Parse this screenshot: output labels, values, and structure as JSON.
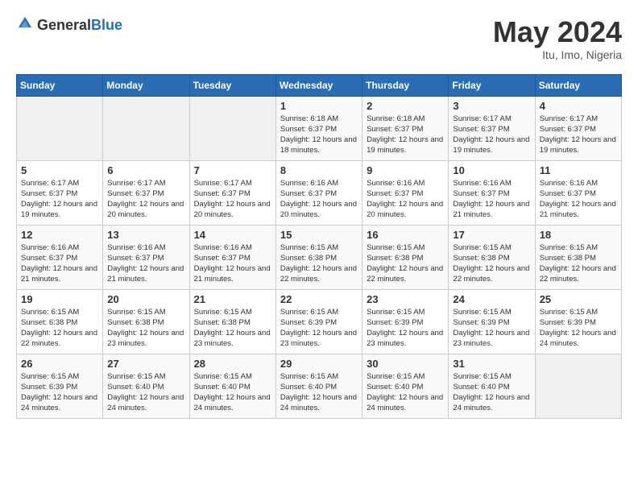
{
  "header": {
    "logo_general": "General",
    "logo_blue": "Blue",
    "month": "May 2024",
    "location": "Itu, Imo, Nigeria"
  },
  "weekdays": [
    "Sunday",
    "Monday",
    "Tuesday",
    "Wednesday",
    "Thursday",
    "Friday",
    "Saturday"
  ],
  "weeks": [
    [
      {
        "day": "",
        "sunrise": "",
        "sunset": "",
        "daylight": ""
      },
      {
        "day": "",
        "sunrise": "",
        "sunset": "",
        "daylight": ""
      },
      {
        "day": "",
        "sunrise": "",
        "sunset": "",
        "daylight": ""
      },
      {
        "day": "1",
        "sunrise": "6:18 AM",
        "sunset": "6:37 PM",
        "daylight": "12 hours and 18 minutes."
      },
      {
        "day": "2",
        "sunrise": "6:18 AM",
        "sunset": "6:37 PM",
        "daylight": "12 hours and 19 minutes."
      },
      {
        "day": "3",
        "sunrise": "6:17 AM",
        "sunset": "6:37 PM",
        "daylight": "12 hours and 19 minutes."
      },
      {
        "day": "4",
        "sunrise": "6:17 AM",
        "sunset": "6:37 PM",
        "daylight": "12 hours and 19 minutes."
      }
    ],
    [
      {
        "day": "5",
        "sunrise": "6:17 AM",
        "sunset": "6:37 PM",
        "daylight": "12 hours and 19 minutes."
      },
      {
        "day": "6",
        "sunrise": "6:17 AM",
        "sunset": "6:37 PM",
        "daylight": "12 hours and 20 minutes."
      },
      {
        "day": "7",
        "sunrise": "6:17 AM",
        "sunset": "6:37 PM",
        "daylight": "12 hours and 20 minutes."
      },
      {
        "day": "8",
        "sunrise": "6:16 AM",
        "sunset": "6:37 PM",
        "daylight": "12 hours and 20 minutes."
      },
      {
        "day": "9",
        "sunrise": "6:16 AM",
        "sunset": "6:37 PM",
        "daylight": "12 hours and 20 minutes."
      },
      {
        "day": "10",
        "sunrise": "6:16 AM",
        "sunset": "6:37 PM",
        "daylight": "12 hours and 21 minutes."
      },
      {
        "day": "11",
        "sunrise": "6:16 AM",
        "sunset": "6:37 PM",
        "daylight": "12 hours and 21 minutes."
      }
    ],
    [
      {
        "day": "12",
        "sunrise": "6:16 AM",
        "sunset": "6:37 PM",
        "daylight": "12 hours and 21 minutes."
      },
      {
        "day": "13",
        "sunrise": "6:16 AM",
        "sunset": "6:37 PM",
        "daylight": "12 hours and 21 minutes."
      },
      {
        "day": "14",
        "sunrise": "6:16 AM",
        "sunset": "6:37 PM",
        "daylight": "12 hours and 21 minutes."
      },
      {
        "day": "15",
        "sunrise": "6:15 AM",
        "sunset": "6:38 PM",
        "daylight": "12 hours and 22 minutes."
      },
      {
        "day": "16",
        "sunrise": "6:15 AM",
        "sunset": "6:38 PM",
        "daylight": "12 hours and 22 minutes."
      },
      {
        "day": "17",
        "sunrise": "6:15 AM",
        "sunset": "6:38 PM",
        "daylight": "12 hours and 22 minutes."
      },
      {
        "day": "18",
        "sunrise": "6:15 AM",
        "sunset": "6:38 PM",
        "daylight": "12 hours and 22 minutes."
      }
    ],
    [
      {
        "day": "19",
        "sunrise": "6:15 AM",
        "sunset": "6:38 PM",
        "daylight": "12 hours and 22 minutes."
      },
      {
        "day": "20",
        "sunrise": "6:15 AM",
        "sunset": "6:38 PM",
        "daylight": "12 hours and 23 minutes."
      },
      {
        "day": "21",
        "sunrise": "6:15 AM",
        "sunset": "6:38 PM",
        "daylight": "12 hours and 23 minutes."
      },
      {
        "day": "22",
        "sunrise": "6:15 AM",
        "sunset": "6:39 PM",
        "daylight": "12 hours and 23 minutes."
      },
      {
        "day": "23",
        "sunrise": "6:15 AM",
        "sunset": "6:39 PM",
        "daylight": "12 hours and 23 minutes."
      },
      {
        "day": "24",
        "sunrise": "6:15 AM",
        "sunset": "6:39 PM",
        "daylight": "12 hours and 23 minutes."
      },
      {
        "day": "25",
        "sunrise": "6:15 AM",
        "sunset": "6:39 PM",
        "daylight": "12 hours and 24 minutes."
      }
    ],
    [
      {
        "day": "26",
        "sunrise": "6:15 AM",
        "sunset": "6:39 PM",
        "daylight": "12 hours and 24 minutes."
      },
      {
        "day": "27",
        "sunrise": "6:15 AM",
        "sunset": "6:40 PM",
        "daylight": "12 hours and 24 minutes."
      },
      {
        "day": "28",
        "sunrise": "6:15 AM",
        "sunset": "6:40 PM",
        "daylight": "12 hours and 24 minutes."
      },
      {
        "day": "29",
        "sunrise": "6:15 AM",
        "sunset": "6:40 PM",
        "daylight": "12 hours and 24 minutes."
      },
      {
        "day": "30",
        "sunrise": "6:15 AM",
        "sunset": "6:40 PM",
        "daylight": "12 hours and 24 minutes."
      },
      {
        "day": "31",
        "sunrise": "6:15 AM",
        "sunset": "6:40 PM",
        "daylight": "12 hours and 24 minutes."
      },
      {
        "day": "",
        "sunrise": "",
        "sunset": "",
        "daylight": ""
      }
    ]
  ]
}
